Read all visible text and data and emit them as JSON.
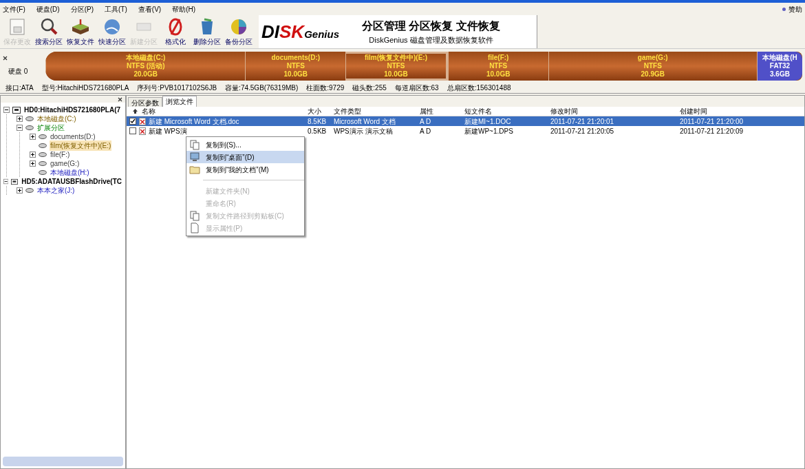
{
  "menu": [
    "文件(F)",
    "硬盘(D)",
    "分区(P)",
    "工具(T)",
    "查看(V)",
    "帮助(H)"
  ],
  "sponsor": "赞助",
  "toolbar": [
    {
      "label": "保存更改",
      "kind": "save",
      "disabled": true
    },
    {
      "label": "搜索分区",
      "kind": "search",
      "disabled": false
    },
    {
      "label": "恢复文件",
      "kind": "recover",
      "disabled": false
    },
    {
      "label": "快速分区",
      "kind": "quick",
      "disabled": false
    },
    {
      "label": "新建分区",
      "kind": "new",
      "disabled": true
    },
    {
      "label": "格式化",
      "kind": "format",
      "disabled": false
    },
    {
      "label": "删除分区",
      "kind": "delete",
      "disabled": false
    },
    {
      "label": "备份分区",
      "kind": "backup",
      "disabled": false
    }
  ],
  "logo": {
    "part1": "DI",
    "part2": "SK",
    "part3": "Genius"
  },
  "banner": {
    "title": "分区管理 分区恢复 文件恢复",
    "subtitle": "DiskGenius 磁盘管理及数据恢复软件"
  },
  "disk_label": "硬盘 0",
  "partitions": [
    {
      "name": "本地磁盘(C:)",
      "fs": "NTFS (活动)",
      "size": "20.0GB",
      "kind": "ntfs",
      "selected": false
    },
    {
      "name": "documents(D:)",
      "fs": "NTFS",
      "size": "10.0GB",
      "kind": "ntfs",
      "selected": false
    },
    {
      "name": "film(恢复文件中)(E:)",
      "fs": "NTFS",
      "size": "10.0GB",
      "kind": "ntfs",
      "selected": true
    },
    {
      "name": "file(F:)",
      "fs": "NTFS",
      "size": "10.0GB",
      "kind": "ntfs",
      "selected": false
    },
    {
      "name": "game(G:)",
      "fs": "NTFS",
      "size": "20.9GB",
      "kind": "ntfs",
      "selected": false
    },
    {
      "name": "本地磁盘(H",
      "fs": "FAT32",
      "size": "3.6GB",
      "kind": "fat32",
      "selected": false
    }
  ],
  "disk_info": [
    "接口:ATA",
    "型号:HitachiHDS721680PLA",
    "序列号:PVB1017102S6JB",
    "容量:74.5GB(76319MB)",
    "柱面数:9729",
    "磁头数:255",
    "每道扇区数:63",
    "总扇区数:156301488"
  ],
  "tree": [
    {
      "label": "HD0:HitachiHDS721680PLA(7",
      "kind": "disk",
      "expanded": true,
      "selected": false,
      "children": [
        {
          "label": "本地磁盘(C:)",
          "kind": "primary",
          "expanded": false,
          "selected": false
        },
        {
          "label": "扩展分区",
          "kind": "extended",
          "expanded": true,
          "selected": false,
          "children": [
            {
              "label": "documents(D:)",
              "kind": "logical",
              "expanded": false,
              "selected": false
            },
            {
              "label": "film(恢复文件中)(E:)",
              "kind": "logical",
              "selected": true
            },
            {
              "label": "file(F:)",
              "kind": "logical",
              "expanded": false,
              "selected": false
            },
            {
              "label": "game(G:)",
              "kind": "logical",
              "expanded": false,
              "selected": false
            },
            {
              "label": "本地磁盘(H:)",
              "kind": "foreign",
              "selected": false
            }
          ]
        }
      ]
    },
    {
      "label": "HD5:ADATAUSBFlashDrive(TC",
      "kind": "disk",
      "expanded": true,
      "selected": false,
      "children": [
        {
          "label": "本本之家(J:)",
          "kind": "foreign",
          "expanded": false,
          "selected": false
        }
      ]
    }
  ],
  "tabs": [
    {
      "label": "分区参数",
      "selected": false
    },
    {
      "label": "浏览文件",
      "selected": true
    }
  ],
  "columns": [
    "名称",
    "大小",
    "文件类型",
    "属性",
    "短文件名",
    "修改时间",
    "创建时间"
  ],
  "rows": [
    {
      "checked": true,
      "selected": true,
      "cells": [
        "新建 Microsoft Word 文档.doc",
        "8.5KB",
        "Microsoft Word 文档",
        "A D",
        "新建MI~1.DOC",
        "2011-07-21 21:20:01",
        "2011-07-21 21:20:00"
      ]
    },
    {
      "checked": false,
      "selected": false,
      "cells": [
        "新建 WPS演",
        "0.5KB",
        "WPS演示 演示文稿",
        "A D",
        "新建WP~1.DPS",
        "2011-07-21 21:20:05",
        "2011-07-21 21:20:09"
      ]
    }
  ],
  "context_menu": [
    {
      "label": "复制到(S)...",
      "kind": "copy",
      "disabled": false,
      "selected": false
    },
    {
      "label": "复制到“桌面”(D)",
      "kind": "desktop",
      "disabled": false,
      "selected": true
    },
    {
      "label": "复制到“我的文档”(M)",
      "kind": "folder",
      "disabled": false,
      "selected": false
    },
    {
      "kind": "separator"
    },
    {
      "label": "新建文件夹(N)",
      "kind": "plain",
      "disabled": true,
      "selected": false
    },
    {
      "label": "重命名(R)",
      "kind": "plain",
      "disabled": true,
      "selected": false
    },
    {
      "label": "复制文件路径到剪贴板(C)",
      "kind": "copy",
      "disabled": true,
      "selected": false
    },
    {
      "label": "显示属性(P)",
      "kind": "document",
      "disabled": true,
      "selected": false
    }
  ]
}
